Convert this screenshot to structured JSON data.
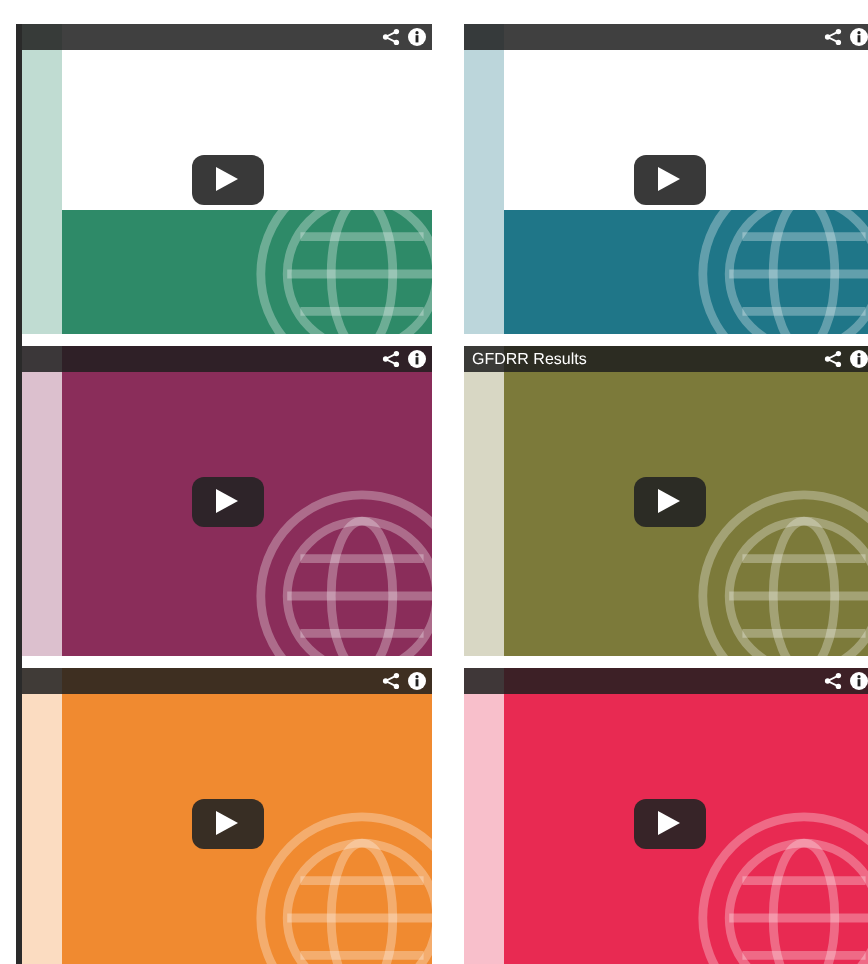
{
  "videos": [
    {
      "kind": "band",
      "color": "#2e8a68"
    },
    {
      "kind": "band",
      "color": "#1f7688"
    },
    {
      "kind": "full",
      "color": "#8a2d5a"
    },
    {
      "kind": "full",
      "color": "#7c7a3a",
      "title": "GFDRR Results"
    },
    {
      "kind": "full",
      "color": "#f08a30"
    },
    {
      "kind": "full",
      "color": "#e82a52"
    }
  ]
}
